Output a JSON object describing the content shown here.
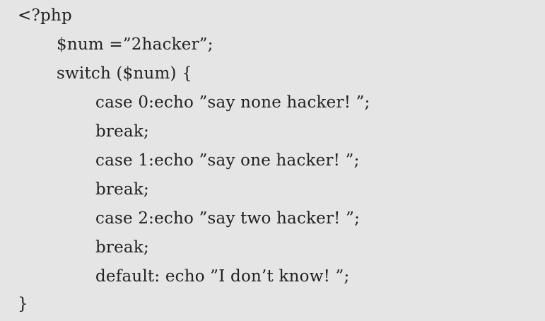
{
  "code": {
    "lines": [
      {
        "indent": 0,
        "text": "<?php"
      },
      {
        "indent": 1,
        "text": "$num =”2hacker”;"
      },
      {
        "indent": 1,
        "text": "switch ($num) {"
      },
      {
        "indent": 2,
        "text": "case 0:echo ”say none hacker! ”;"
      },
      {
        "indent": 2,
        "text": "break;"
      },
      {
        "indent": 2,
        "text": "case 1:echo ”say one hacker! ”;"
      },
      {
        "indent": 2,
        "text": "break;"
      },
      {
        "indent": 2,
        "text": "case 2:echo ”say two hacker! ”;"
      },
      {
        "indent": 2,
        "text": "break;"
      },
      {
        "indent": 2,
        "text": "default: echo ”I don’t know! ”;"
      },
      {
        "indent": 0,
        "text": "}"
      }
    ]
  }
}
